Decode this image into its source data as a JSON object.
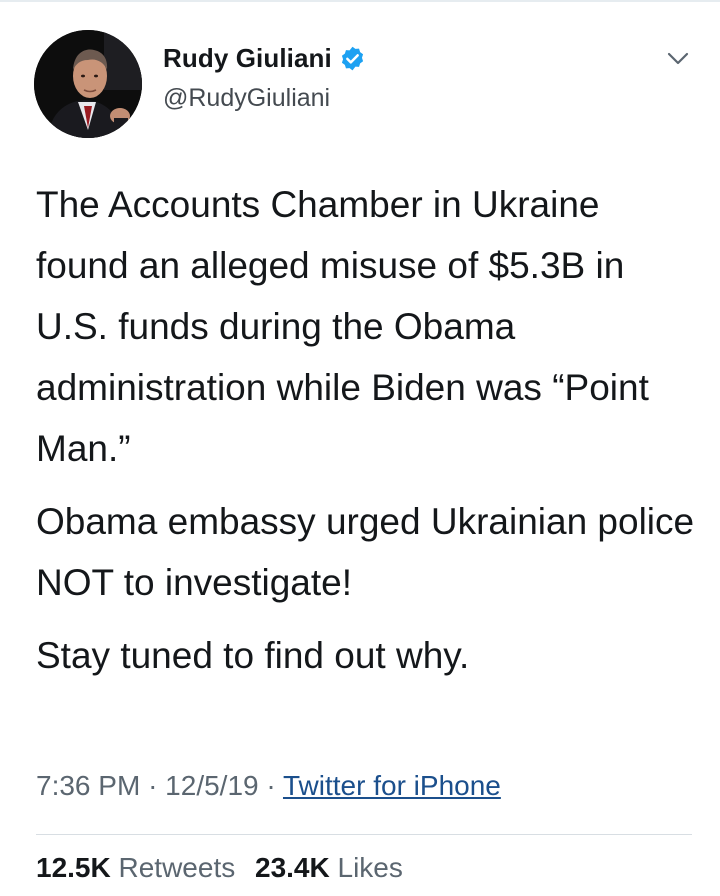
{
  "user": {
    "display_name": "Rudy Giuliani",
    "handle": "@RudyGiuliani",
    "verified_icon": "verified-badge-icon"
  },
  "tweet": {
    "paragraphs": [
      "The Accounts Chamber in Ukraine found an alleged misuse of $5.3B in U.S. funds during the Obama administration while Biden was “Point Man.”",
      "Obama embassy urged Ukrainian police NOT to investigate!",
      "Stay tuned to find out why."
    ]
  },
  "meta": {
    "time": "7:36 PM",
    "date": "12/5/19",
    "separator": "·",
    "source": "Twitter for iPhone"
  },
  "stats": {
    "retweets_count": "12.5K",
    "retweets_label": "Retweets",
    "likes_count": "23.4K",
    "likes_label": "Likes"
  },
  "colors": {
    "verified_blue": "#1da1f2",
    "link": "#1b4f8c",
    "text": "#14171a",
    "muted": "#5b6670"
  }
}
